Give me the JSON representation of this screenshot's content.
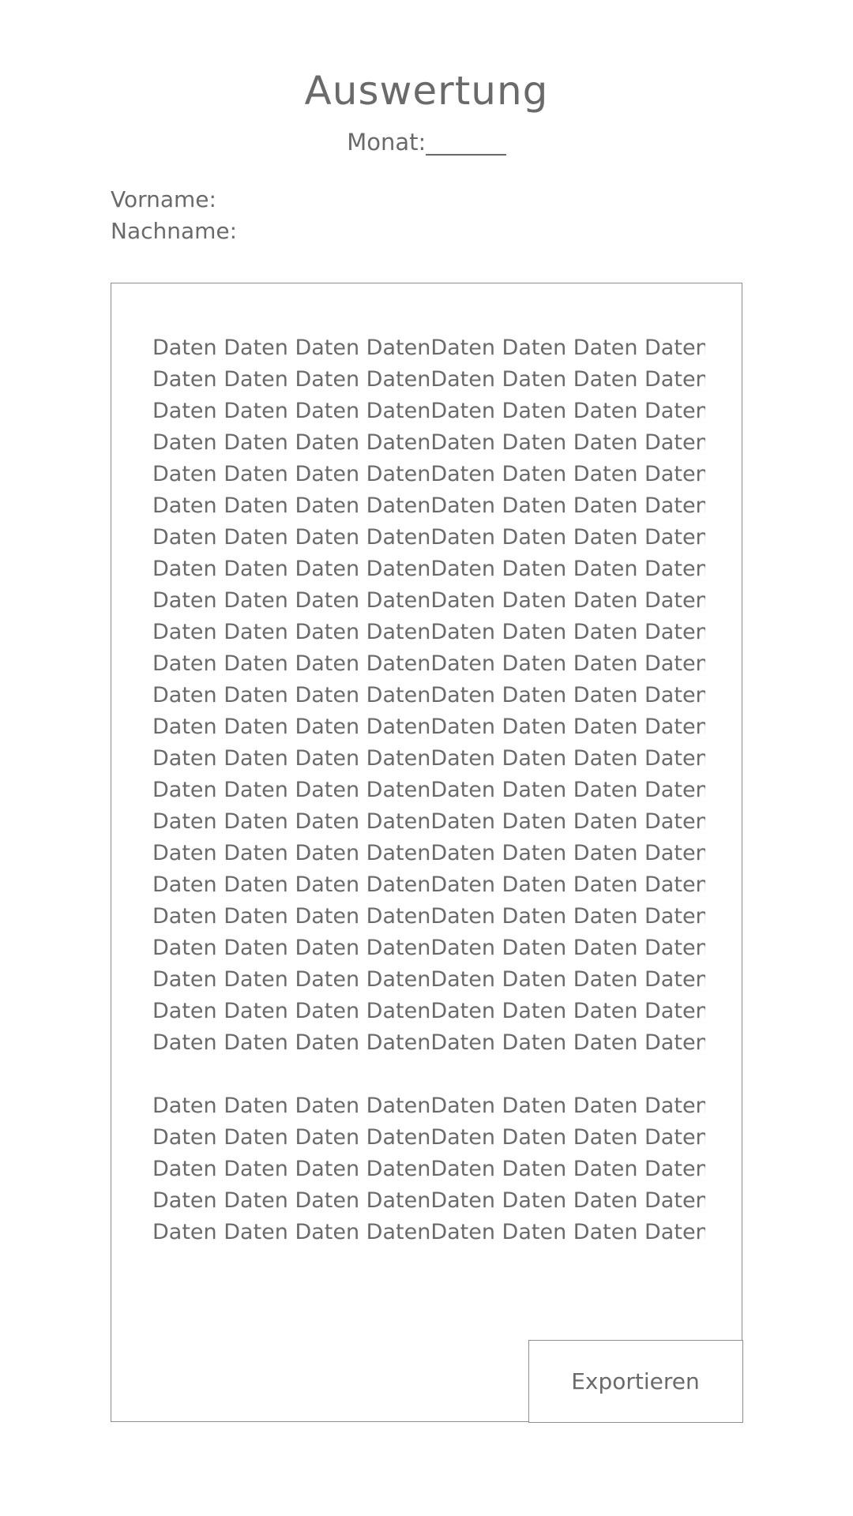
{
  "header": {
    "title": "Auswertung",
    "month_label": "Monat:_______"
  },
  "person": {
    "first_name_label": "Vorname:",
    "last_name_label": "Nachname:"
  },
  "data_panel": {
    "block_1": [
      "Daten Daten Daten DatenDaten Daten Daten Daten",
      "Daten Daten Daten DatenDaten Daten Daten Daten",
      "Daten Daten Daten DatenDaten Daten Daten Daten",
      "Daten Daten Daten DatenDaten Daten Daten Daten",
      "Daten Daten Daten DatenDaten Daten Daten Daten",
      "Daten Daten Daten DatenDaten Daten Daten Daten",
      "Daten Daten Daten DatenDaten Daten Daten Daten",
      "Daten Daten Daten DatenDaten Daten Daten Daten",
      "Daten Daten Daten DatenDaten Daten Daten Daten",
      "Daten Daten Daten DatenDaten Daten Daten Daten",
      "Daten Daten Daten DatenDaten Daten Daten Daten",
      "Daten Daten Daten DatenDaten Daten Daten Daten",
      "Daten Daten Daten DatenDaten Daten Daten Daten",
      "Daten Daten Daten DatenDaten Daten Daten Daten",
      "Daten Daten Daten DatenDaten Daten Daten Daten",
      "Daten Daten Daten DatenDaten Daten Daten Daten",
      "Daten Daten Daten DatenDaten Daten Daten Daten",
      "Daten Daten Daten DatenDaten Daten Daten Daten",
      "Daten Daten Daten DatenDaten Daten Daten Daten",
      "Daten Daten Daten DatenDaten Daten Daten Daten",
      "Daten Daten Daten DatenDaten Daten Daten Daten",
      "Daten Daten Daten DatenDaten Daten Daten Daten",
      "Daten Daten Daten DatenDaten Daten Daten Daten"
    ],
    "block_2": [
      "Daten Daten Daten DatenDaten Daten Daten Daten",
      "Daten Daten Daten DatenDaten Daten Daten Daten",
      "Daten Daten Daten DatenDaten Daten Daten Daten",
      "Daten Daten Daten DatenDaten Daten Daten Daten",
      "Daten Daten Daten DatenDaten Daten Daten Daten"
    ],
    "export_label": "Exportieren"
  }
}
